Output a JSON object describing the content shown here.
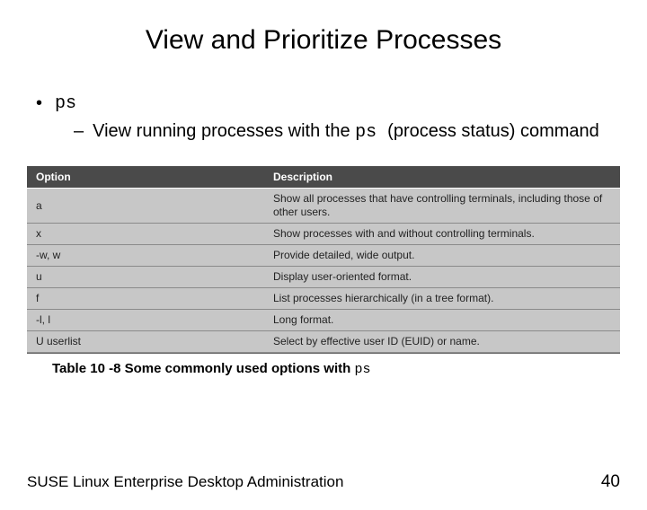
{
  "title": "View and Prioritize Processes",
  "bullet": {
    "label": "ps"
  },
  "sub": {
    "pre": "View running processes with the ",
    "cmd": "ps ",
    "post": "(process status) command"
  },
  "table": {
    "headers": {
      "option": "Option",
      "description": "Description"
    },
    "rows": [
      {
        "opt": "a",
        "desc": "Show all processes that have controlling terminals, including those of other users."
      },
      {
        "opt": "x",
        "desc": "Show processes with and without controlling terminals."
      },
      {
        "opt": "-w, w",
        "desc": "Provide detailed, wide output."
      },
      {
        "opt": "u",
        "desc": "Display user-oriented format."
      },
      {
        "opt": "f",
        "desc": "List processes hierarchically (in a tree format)."
      },
      {
        "opt": "-l, l",
        "desc": "Long format."
      },
      {
        "opt": "U userlist",
        "desc": "Select by effective user ID (EUID) or name."
      }
    ]
  },
  "caption": {
    "label": "Table 10 -8 Some commonly used options with ",
    "cmd": "ps"
  },
  "footer": {
    "label": "SUSE Linux Enterprise Desktop Administration",
    "page": "40"
  }
}
